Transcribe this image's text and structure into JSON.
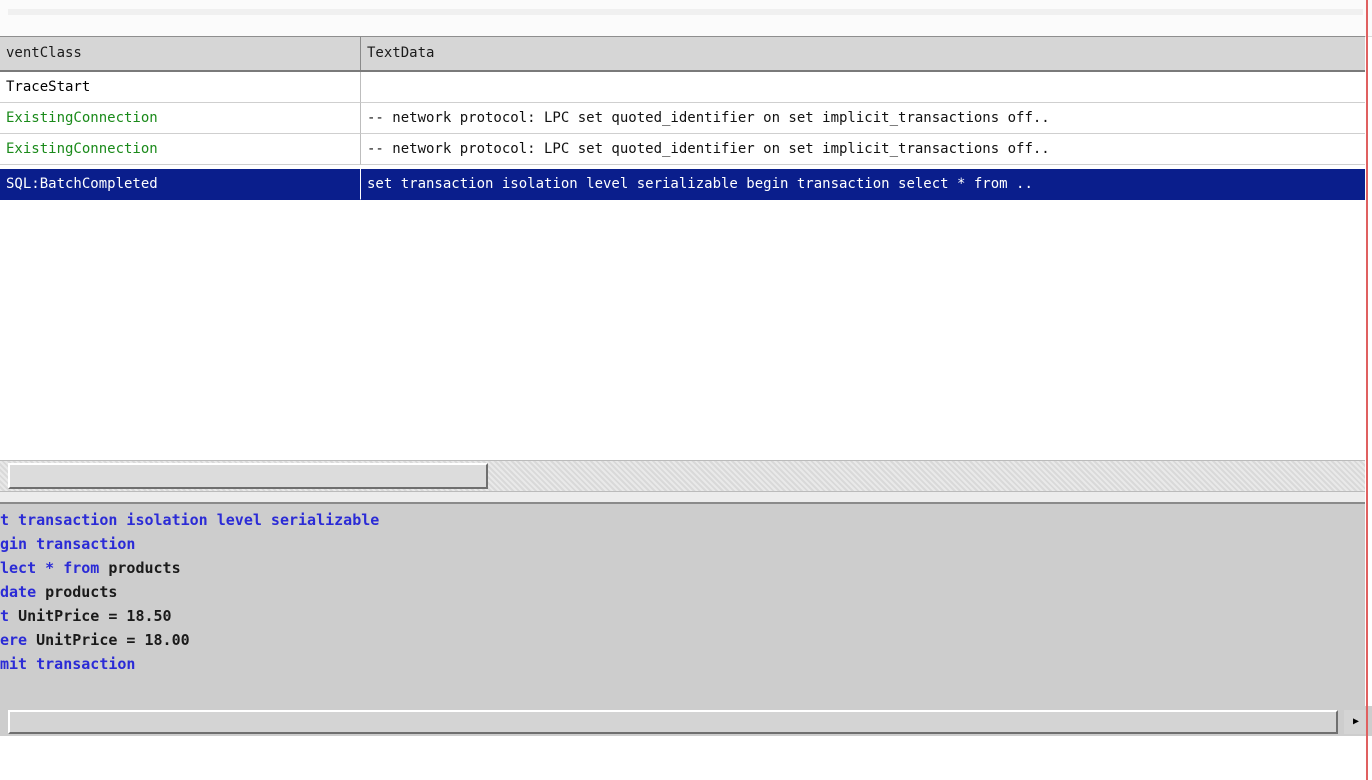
{
  "columns": {
    "event_class": "ventClass",
    "text_data": "TextData"
  },
  "rows": [
    {
      "event_class": "TraceStart",
      "text_data": "",
      "color": "#1a1a1a",
      "selected": false
    },
    {
      "event_class": "ExistingConnection",
      "text_data": "-- network protocol: LPC set quoted_identifier on set implicit_transactions off..",
      "color": "#1a8a1a",
      "selected": false
    },
    {
      "event_class": "ExistingConnection",
      "text_data": "-- network protocol: LPC set quoted_identifier on set implicit_transactions off..",
      "color": "#1a8a1a",
      "selected": false
    },
    {
      "event_class": "SQL:BatchCompleted",
      "text_data": "set transaction isolation level serializable  begin transaction  select * from ..",
      "color": "#ffffff",
      "selected": true
    }
  ],
  "sql_lines": [
    {
      "kw": "t transaction isolation level serializable",
      "rest": ""
    },
    {
      "kw": "gin transaction",
      "rest": ""
    },
    {
      "kw": "lect * from ",
      "rest": "products"
    },
    {
      "kw": "date ",
      "rest": "products"
    },
    {
      "kw": "t ",
      "rest": "UnitPrice = 18.50"
    },
    {
      "kw": "ere ",
      "rest": "UnitPrice = 18.00"
    },
    {
      "kw": "mit transaction",
      "rest": ""
    }
  ],
  "colors": {
    "selection": "#0a1e8c",
    "keyword": "#2b2bd6",
    "existing_connection": "#1a8a1a"
  },
  "icons": {
    "scroll_right": "arrow-right-icon"
  }
}
